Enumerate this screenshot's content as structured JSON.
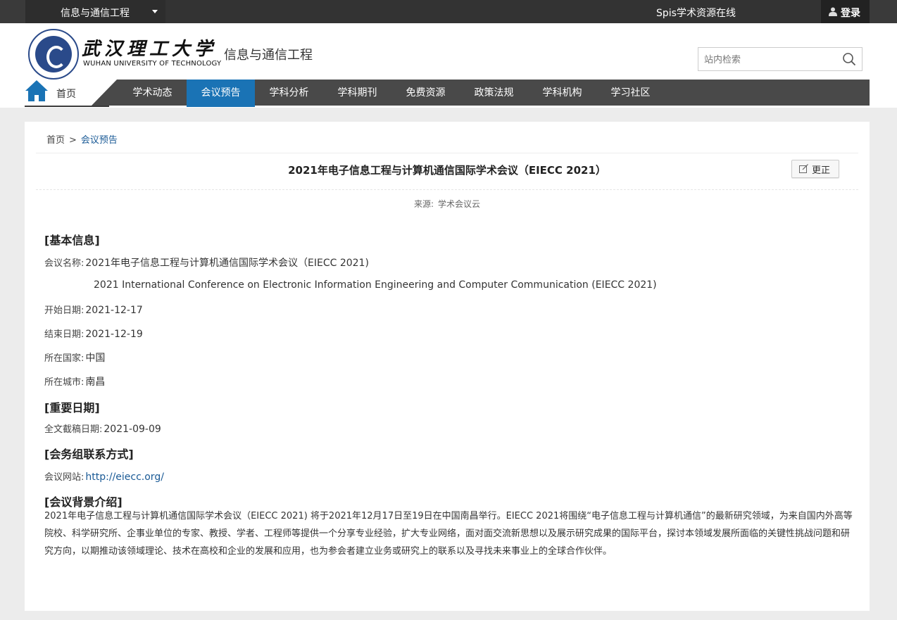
{
  "topbar": {
    "site_select": "信息与通信工程",
    "title": "Spis学术资源在线",
    "login": "登录"
  },
  "header": {
    "university_cn": "武汉理工大学",
    "university_en": "WUHAN UNIVERSITY OF TECHNOLOGY",
    "department": "信息与通信工程",
    "search_placeholder": "站内检索"
  },
  "nav": {
    "home": "首页",
    "items": [
      "学术动态",
      "会议预告",
      "学科分析",
      "学科期刊",
      "免费资源",
      "政策法规",
      "学科机构",
      "学习社区"
    ],
    "active_index": 1,
    "active_color": "#1a73b5"
  },
  "breadcrumb": {
    "home": "首页",
    "sep": ">",
    "current": "会议预告"
  },
  "article": {
    "title": "2021年电子信息工程与计算机通信国际学术会议（EIECC 2021）",
    "correct_label": "更正",
    "source_label": "来源:",
    "source_value": "学术会议云"
  },
  "basic": {
    "heading": "[基本信息]",
    "name_label": "会议名称:",
    "name_cn": "2021年电子信息工程与计算机通信国际学术会议（EIECC 2021)",
    "name_en": "2021 International Conference on Electronic Information Engineering and Computer Communication (EIECC 2021)",
    "start_label": "开始日期:",
    "start": "2021-12-17",
    "end_label": "结束日期:",
    "end": "2021-12-19",
    "country_label": "所在国家:",
    "country": "中国",
    "city_label": "所在城市:",
    "city": "南昌"
  },
  "dates": {
    "heading": "[重要日期]",
    "deadline_label": "全文截稿日期:",
    "deadline": "2021-09-09"
  },
  "contact": {
    "heading": "[会务组联系方式]",
    "site_label": "会议网站:",
    "site": "http://eiecc.org/"
  },
  "background": {
    "heading": "[会议背景介绍]",
    "text": "2021年电子信息工程与计算机通信国际学术会议（EIECC 2021) 将于2021年12月17日至19日在中国南昌举行。EIECC 2021将围绕“电子信息工程与计算机通信”的最新研究领域，为来自国内外高等院校、科学研究所、企事业单位的专家、教授、学者、工程师等提供一个分享专业经验，扩大专业网络，面对面交流新思想以及展示研究成果的国际平台，探讨本领域发展所面临的关键性挑战问题和研究方向，以期推动该领域理论、技术在高校和企业的发展和应用，也为参会者建立业务或研究上的联系以及寻找未来事业上的全球合作伙伴。"
  }
}
